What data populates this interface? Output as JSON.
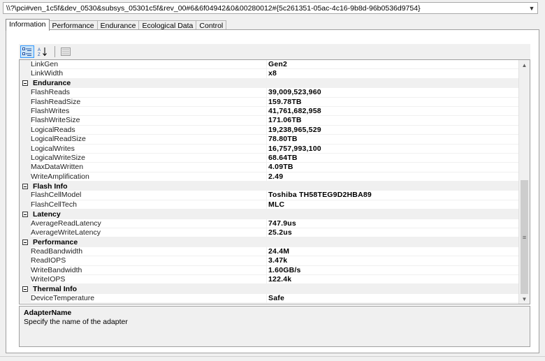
{
  "device": {
    "path": "\\\\?\\pci#ven_1c5f&dev_0530&subsys_05301c5f&rev_00#6&6f04942&0&00280012#{5c261351-05ac-4c16-9b8d-96b0536d9754}"
  },
  "tabs": [
    {
      "label": "Information",
      "active": true
    },
    {
      "label": "Performance",
      "active": false
    },
    {
      "label": "Endurance",
      "active": false
    },
    {
      "label": "Ecological Data",
      "active": false
    },
    {
      "label": "Control",
      "active": false
    }
  ],
  "toolbar": {
    "categorized_icon": "categorized-view-icon",
    "alphabetical_icon": "alphabetical-sort-icon",
    "property_pages_icon": "property-pages-icon"
  },
  "grid": {
    "rows": [
      {
        "kind": "prop",
        "name": "LinkGen",
        "value": "Gen2"
      },
      {
        "kind": "prop",
        "name": "LinkWidth",
        "value": "x8"
      },
      {
        "kind": "cat",
        "name": "Endurance"
      },
      {
        "kind": "prop",
        "name": "FlashReads",
        "value": "39,009,523,960"
      },
      {
        "kind": "prop",
        "name": "FlashReadSize",
        "value": "159.78TB"
      },
      {
        "kind": "prop",
        "name": "FlashWrites",
        "value": "41,761,682,958"
      },
      {
        "kind": "prop",
        "name": "FlashWriteSize",
        "value": "171.06TB"
      },
      {
        "kind": "prop",
        "name": "LogicalReads",
        "value": "19,238,965,529"
      },
      {
        "kind": "prop",
        "name": "LogicalReadSize",
        "value": "78.80TB"
      },
      {
        "kind": "prop",
        "name": "LogicalWrites",
        "value": "16,757,993,100"
      },
      {
        "kind": "prop",
        "name": "LogicalWriteSize",
        "value": "68.64TB"
      },
      {
        "kind": "prop",
        "name": "MaxDataWritten",
        "value": "4.09TB"
      },
      {
        "kind": "prop",
        "name": "WriteAmplification",
        "value": "2.49"
      },
      {
        "kind": "cat",
        "name": "Flash Info"
      },
      {
        "kind": "prop",
        "name": "FlashCellModel",
        "value": "Toshiba TH58TEG9D2HBA89"
      },
      {
        "kind": "prop",
        "name": "FlashCellTech",
        "value": "MLC"
      },
      {
        "kind": "cat",
        "name": "Latency"
      },
      {
        "kind": "prop",
        "name": "AverageReadLatency",
        "value": "747.9us"
      },
      {
        "kind": "prop",
        "name": "AverageWriteLatency",
        "value": "25.2us"
      },
      {
        "kind": "cat",
        "name": "Performance"
      },
      {
        "kind": "prop",
        "name": "ReadBandwidth",
        "value": "24.4M"
      },
      {
        "kind": "prop",
        "name": "ReadIOPS",
        "value": "3.47k"
      },
      {
        "kind": "prop",
        "name": "WriteBandwidth",
        "value": "1.60GB/s"
      },
      {
        "kind": "prop",
        "name": "WriteIOPS",
        "value": "122.4k"
      },
      {
        "kind": "cat",
        "name": "Thermal Info"
      },
      {
        "kind": "prop",
        "name": "DeviceTemperature",
        "value": "Safe"
      }
    ]
  },
  "help": {
    "title": "AdapterName",
    "description": "Specify the name of the adapter"
  }
}
